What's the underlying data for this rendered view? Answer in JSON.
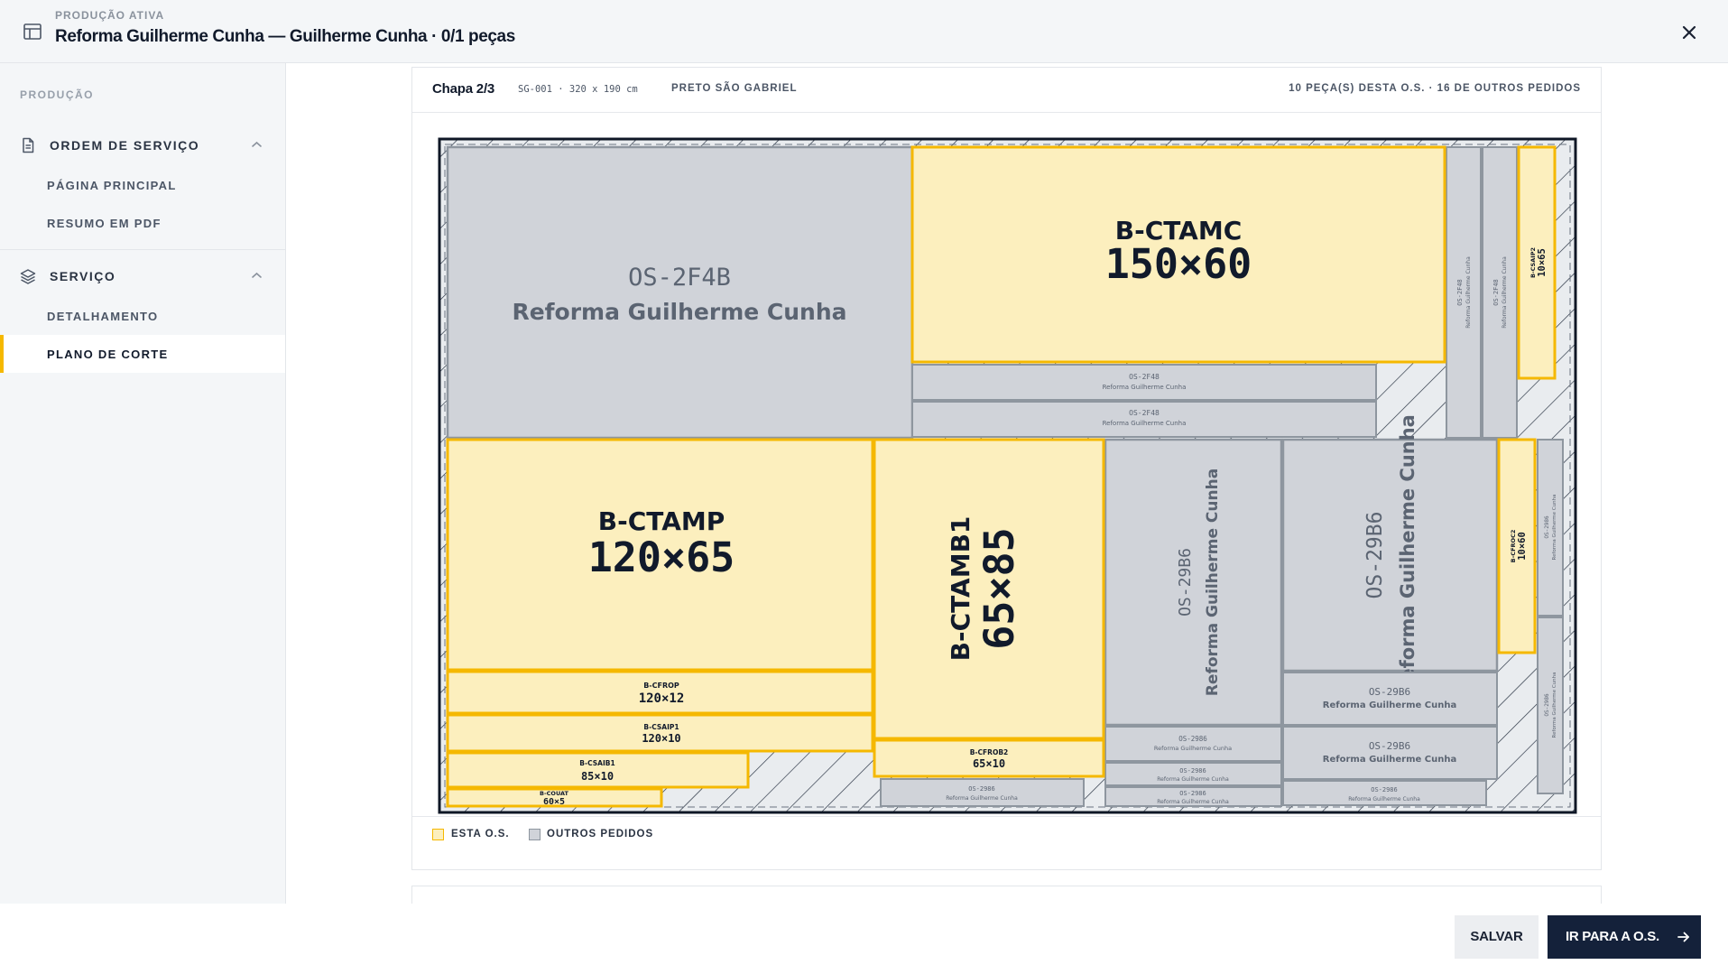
{
  "header": {
    "eyebrow": "PRODUÇÃO ATIVA",
    "title": "Reforma Guilherme Cunha — Guilherme Cunha · 0/1 peças"
  },
  "sidebar": {
    "section_title": "PRODUÇÃO",
    "groups": [
      {
        "label": "ORDEM DE SERVIÇO",
        "icon": "document-icon",
        "items": [
          "PÁGINA PRINCIPAL",
          "RESUMO EM PDF"
        ]
      },
      {
        "label": "SERVIÇO",
        "icon": "layers-icon",
        "items": [
          "DETALHAMENTO",
          "PLANO DE CORTE"
        ]
      }
    ],
    "active_item": "PLANO DE CORTE"
  },
  "sheet": {
    "label": "Chapa 2/3",
    "code": "SG-001 · 320 x 190 cm",
    "material": "PRETO SÃO GABRIEL",
    "count": "10 PEÇA(S) DESTA O.S. · 16 DE OUTROS PEDIDOS"
  },
  "pieces": {
    "ctamc": {
      "code": "B-CTAMC",
      "dims": "150×60"
    },
    "ctamp": {
      "code": "B-CTAMP",
      "dims": "120×65"
    },
    "ctamb1": {
      "code": "B-CTAMB1",
      "dims": "65×85"
    },
    "cfrop": {
      "code": "B-CFROP",
      "dims": "120×12"
    },
    "csaip1": {
      "code": "B-CSAIP1",
      "dims": "120×10"
    },
    "csaib1": {
      "code": "B-CSAIB1",
      "dims": "85×10"
    },
    "couat": {
      "code": "B-COUAT",
      "dims": "60×5"
    },
    "cfrob2": {
      "code": "B-CFROB2",
      "dims": "65×10"
    },
    "csaip2": {
      "code": "B-CSAIP2",
      "dims": "10×65"
    },
    "cfroc2": {
      "code": "B-CFROC2",
      "dims": "10×60"
    }
  },
  "others": {
    "os_2f4b": "OS-2F4B",
    "os_2f48": "OS-2F48",
    "os_29b6": "OS-29B6",
    "os_2986": "OS-2986",
    "client": "Reforma Guilherme Cunha"
  },
  "legend": {
    "this_os": "ESTA O.S.",
    "other_orders": "OUTROS PEDIDOS"
  },
  "footer": {
    "save": "SALVAR",
    "go": "IR PARA A O.S."
  },
  "colors": {
    "this_os_fill": "#fcefbe",
    "this_os_stroke": "#f5b800",
    "other_fill": "#d0d3d9",
    "other_stroke": "#8e969f",
    "primary": "#14213a"
  }
}
